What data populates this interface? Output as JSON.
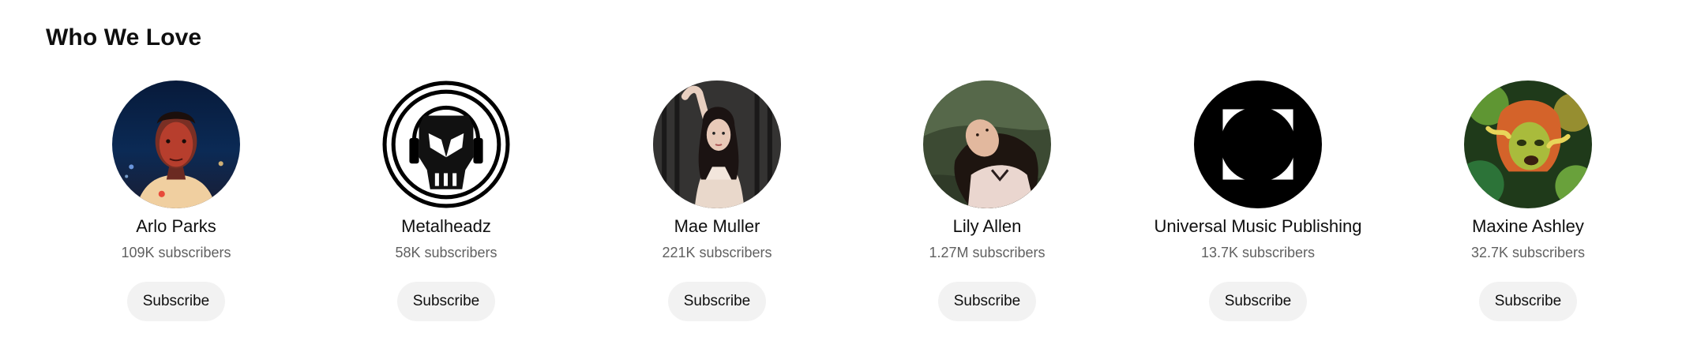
{
  "section": {
    "title": "Who We Love"
  },
  "channels": [
    {
      "name": "Arlo Parks",
      "subscribers": "109K subscribers",
      "button": "Subscribe",
      "avatar": "portrait-photo"
    },
    {
      "name": "Metalheadz",
      "subscribers": "58K subscribers",
      "button": "Subscribe",
      "avatar": "skull-logo"
    },
    {
      "name": "Mae Muller",
      "subscribers": "221K subscribers",
      "button": "Subscribe",
      "avatar": "portrait-photo"
    },
    {
      "name": "Lily Allen",
      "subscribers": "1.27M subscribers",
      "button": "Subscribe",
      "avatar": "portrait-photo"
    },
    {
      "name": "Universal Music Publishing",
      "subscribers": "13.7K subscribers",
      "button": "Subscribe",
      "avatar": "bracket-circle-logo"
    },
    {
      "name": "Maxine Ashley",
      "subscribers": "32.7K subscribers",
      "button": "Subscribe",
      "avatar": "portrait-photo"
    }
  ],
  "colors": {
    "button_bg": "#f2f2f2",
    "subtext": "#606060",
    "text": "#0f0f0f"
  }
}
